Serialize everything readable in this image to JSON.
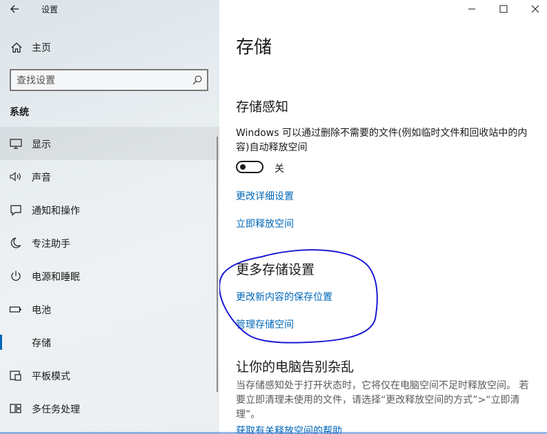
{
  "window": {
    "app_title": "设置",
    "back_icon": "arrow-left-icon",
    "caption_buttons": {
      "minimize_icon": "minimize-icon",
      "maximize_icon": "maximize-icon",
      "close_icon": "close-icon"
    }
  },
  "sidebar": {
    "home": {
      "label": "主页",
      "icon": "home-icon"
    },
    "search": {
      "placeholder": "查找设置",
      "value": "",
      "icon": "search-icon"
    },
    "section_title": "系统",
    "items": [
      {
        "label": "显示",
        "icon": "monitor-icon",
        "selected": false,
        "hovered": true
      },
      {
        "label": "声音",
        "icon": "speaker-icon",
        "selected": false
      },
      {
        "label": "通知和操作",
        "icon": "notification-icon",
        "selected": false
      },
      {
        "label": "专注助手",
        "icon": "moon-icon",
        "selected": false
      },
      {
        "label": "电源和睡眠",
        "icon": "power-icon",
        "selected": false
      },
      {
        "label": "电池",
        "icon": "battery-icon",
        "selected": false
      },
      {
        "label": "存储",
        "icon": "storage-icon",
        "selected": true
      },
      {
        "label": "平板模式",
        "icon": "tablet-icon",
        "selected": false
      },
      {
        "label": "多任务处理",
        "icon": "multitask-icon",
        "selected": false
      }
    ]
  },
  "main": {
    "page_title": "存储",
    "storage_sense": {
      "heading": "存储感知",
      "description": "Windows 可以通过删除不需要的文件(例如临时文件和回收站中的内容)自动释放空间",
      "toggle_on": false,
      "toggle_state_label": "关",
      "links": [
        "更改详细设置",
        "立即释放空间"
      ]
    },
    "more_settings": {
      "heading": "更多存储设置",
      "links": [
        "更改新内容的保存位置",
        "管理存储空间"
      ]
    },
    "declutter": {
      "heading": "让你的电脑告别杂乱",
      "description": "当存储感知处于打开状态时，它将仅在电脑空间不足时释放空间。 若要立即清理未使用的文件，请选择“更改释放空间的方式”>“立即清理”。",
      "link": "获取有关释放空间的帮助"
    }
  },
  "colors": {
    "accent": "#0067b8",
    "annotation": "#1a1ad6",
    "text": "#1a1a1a",
    "muted_text": "#5a5a5a",
    "sidebar_bg": "#e8edf0"
  }
}
